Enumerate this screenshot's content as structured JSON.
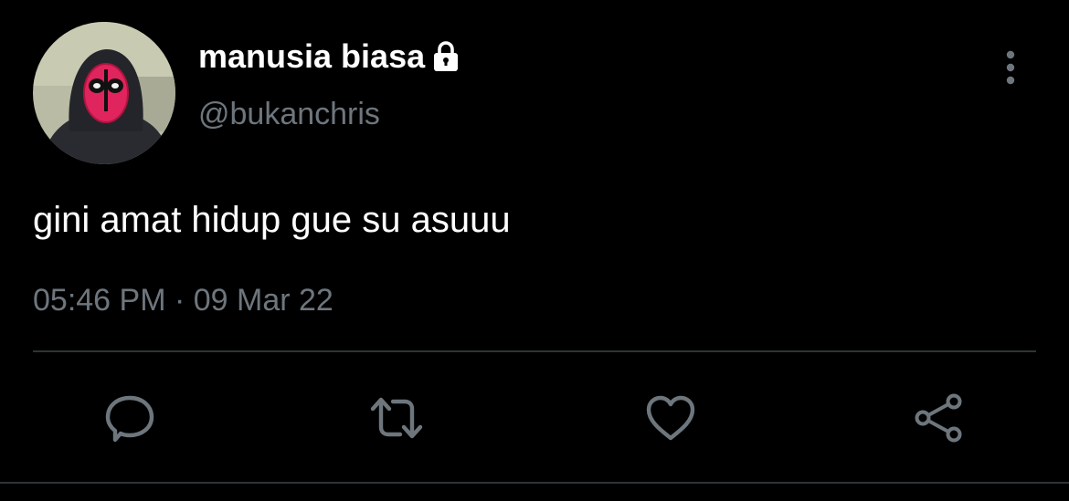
{
  "tweet": {
    "author": {
      "display_name": "manusia biasa",
      "handle": "@bukanchris",
      "protected_icon": "lock-icon",
      "avatar_description_icon": "avatar-image"
    },
    "text": "gini amat hidup gue su asuuu",
    "timestamp": "05:46 PM · 09 Mar 22",
    "more_icon": "more-vertical-icon"
  },
  "actions": [
    {
      "icon": "reply-icon"
    },
    {
      "icon": "retweet-icon"
    },
    {
      "icon": "like-icon"
    },
    {
      "icon": "share-icon"
    }
  ],
  "colors": {
    "background": "#000000",
    "primary_text": "#ffffff",
    "secondary_text": "#6e767d",
    "divider": "#2f3336",
    "icon": "#6e767d"
  }
}
